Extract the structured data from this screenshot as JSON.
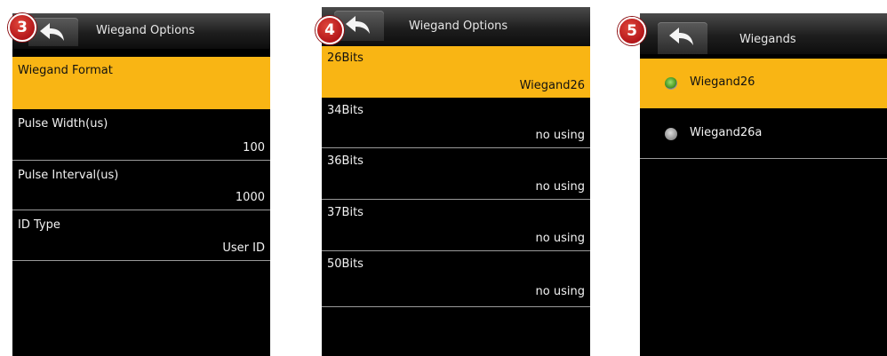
{
  "panel3": {
    "badge": "3",
    "title": "Wiegand Options",
    "rows": [
      {
        "label": "Wiegand Format",
        "value": ""
      },
      {
        "label": "Pulse Width(us)",
        "value": "100"
      },
      {
        "label": "Pulse Interval(us)",
        "value": "1000"
      },
      {
        "label": "ID Type",
        "value": "User ID"
      }
    ]
  },
  "panel4": {
    "badge": "4",
    "title": "Wiegand Options",
    "rows": [
      {
        "label": "26Bits",
        "value": "Wiegand26"
      },
      {
        "label": "34Bits",
        "value": "no using"
      },
      {
        "label": "36Bits",
        "value": "no using"
      },
      {
        "label": "37Bits",
        "value": "no using"
      },
      {
        "label": "50Bits",
        "value": "no using"
      }
    ]
  },
  "panel5": {
    "badge": "5",
    "title": "Wiegands",
    "options": [
      {
        "label": "Wiegand26",
        "selected": true
      },
      {
        "label": "Wiegand26a",
        "selected": false
      }
    ]
  },
  "icons": {
    "back": "back-arrow-icon"
  },
  "colors": {
    "highlight": "#f9b514",
    "screen": "#000000",
    "badge": "#c41e1e"
  }
}
